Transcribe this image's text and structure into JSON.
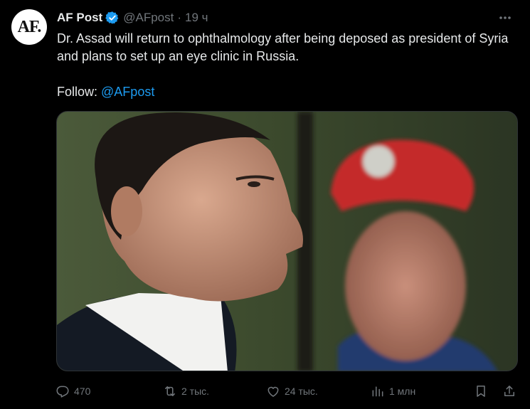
{
  "author": {
    "avatar_text": "AF.",
    "display_name": "AF Post",
    "handle": "@AFpost",
    "time": "19 ч"
  },
  "post": {
    "text": "Dr. Assad will return to ophthalmology after being deposed as president of Syria and plans to set up an eye clinic in Russia.",
    "follow_label": "Follow:",
    "follow_mention": "@AFpost"
  },
  "actions": {
    "replies": "470",
    "reposts": "2 тыс.",
    "likes": "24 тыс.",
    "views": "1 млн"
  },
  "colors": {
    "background": "#000000",
    "text": "#e7e9ea",
    "muted": "#71767b",
    "accent": "#1d9bf0"
  },
  "icons": [
    "verified-badge-icon",
    "more-icon",
    "reply-icon",
    "repost-icon",
    "like-icon",
    "views-icon",
    "bookmark-icon",
    "share-icon"
  ]
}
